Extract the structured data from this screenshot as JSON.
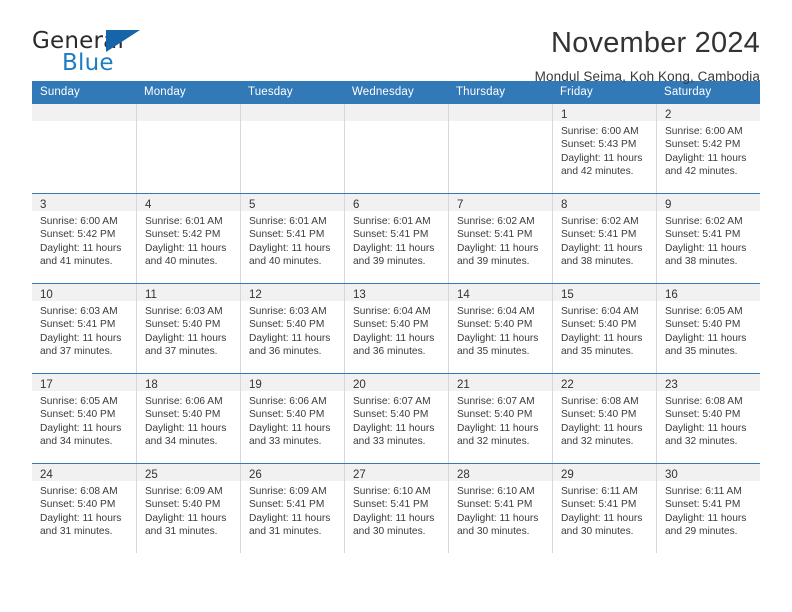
{
  "logo": {
    "word_one": "General",
    "word_two": "Blue",
    "triangle_icon": "blue-triangle-icon",
    "color_dark": "#2b2b2b",
    "color_blue": "#1b7dc4"
  },
  "header": {
    "title": "November 2024",
    "subtitle": "Mondul Seima, Koh Kong, Cambodia"
  },
  "theme": {
    "header_bg": "#3279b8",
    "day_band_bg": "#f1f1f1",
    "grid_line": "#d5d9dd",
    "row_line": "#3279b8"
  },
  "calendar": {
    "weekdays": [
      "Sunday",
      "Monday",
      "Tuesday",
      "Wednesday",
      "Thursday",
      "Friday",
      "Saturday"
    ],
    "weeks": [
      [
        {
          "day": "",
          "lines": []
        },
        {
          "day": "",
          "lines": []
        },
        {
          "day": "",
          "lines": []
        },
        {
          "day": "",
          "lines": []
        },
        {
          "day": "",
          "lines": []
        },
        {
          "day": "1",
          "lines": [
            "Sunrise: 6:00 AM",
            "Sunset: 5:43 PM",
            "Daylight: 11 hours",
            "and 42 minutes."
          ]
        },
        {
          "day": "2",
          "lines": [
            "Sunrise: 6:00 AM",
            "Sunset: 5:42 PM",
            "Daylight: 11 hours",
            "and 42 minutes."
          ]
        }
      ],
      [
        {
          "day": "3",
          "lines": [
            "Sunrise: 6:00 AM",
            "Sunset: 5:42 PM",
            "Daylight: 11 hours",
            "and 41 minutes."
          ]
        },
        {
          "day": "4",
          "lines": [
            "Sunrise: 6:01 AM",
            "Sunset: 5:42 PM",
            "Daylight: 11 hours",
            "and 40 minutes."
          ]
        },
        {
          "day": "5",
          "lines": [
            "Sunrise: 6:01 AM",
            "Sunset: 5:41 PM",
            "Daylight: 11 hours",
            "and 40 minutes."
          ]
        },
        {
          "day": "6",
          "lines": [
            "Sunrise: 6:01 AM",
            "Sunset: 5:41 PM",
            "Daylight: 11 hours",
            "and 39 minutes."
          ]
        },
        {
          "day": "7",
          "lines": [
            "Sunrise: 6:02 AM",
            "Sunset: 5:41 PM",
            "Daylight: 11 hours",
            "and 39 minutes."
          ]
        },
        {
          "day": "8",
          "lines": [
            "Sunrise: 6:02 AM",
            "Sunset: 5:41 PM",
            "Daylight: 11 hours",
            "and 38 minutes."
          ]
        },
        {
          "day": "9",
          "lines": [
            "Sunrise: 6:02 AM",
            "Sunset: 5:41 PM",
            "Daylight: 11 hours",
            "and 38 minutes."
          ]
        }
      ],
      [
        {
          "day": "10",
          "lines": [
            "Sunrise: 6:03 AM",
            "Sunset: 5:41 PM",
            "Daylight: 11 hours",
            "and 37 minutes."
          ]
        },
        {
          "day": "11",
          "lines": [
            "Sunrise: 6:03 AM",
            "Sunset: 5:40 PM",
            "Daylight: 11 hours",
            "and 37 minutes."
          ]
        },
        {
          "day": "12",
          "lines": [
            "Sunrise: 6:03 AM",
            "Sunset: 5:40 PM",
            "Daylight: 11 hours",
            "and 36 minutes."
          ]
        },
        {
          "day": "13",
          "lines": [
            "Sunrise: 6:04 AM",
            "Sunset: 5:40 PM",
            "Daylight: 11 hours",
            "and 36 minutes."
          ]
        },
        {
          "day": "14",
          "lines": [
            "Sunrise: 6:04 AM",
            "Sunset: 5:40 PM",
            "Daylight: 11 hours",
            "and 35 minutes."
          ]
        },
        {
          "day": "15",
          "lines": [
            "Sunrise: 6:04 AM",
            "Sunset: 5:40 PM",
            "Daylight: 11 hours",
            "and 35 minutes."
          ]
        },
        {
          "day": "16",
          "lines": [
            "Sunrise: 6:05 AM",
            "Sunset: 5:40 PM",
            "Daylight: 11 hours",
            "and 35 minutes."
          ]
        }
      ],
      [
        {
          "day": "17",
          "lines": [
            "Sunrise: 6:05 AM",
            "Sunset: 5:40 PM",
            "Daylight: 11 hours",
            "and 34 minutes."
          ]
        },
        {
          "day": "18",
          "lines": [
            "Sunrise: 6:06 AM",
            "Sunset: 5:40 PM",
            "Daylight: 11 hours",
            "and 34 minutes."
          ]
        },
        {
          "day": "19",
          "lines": [
            "Sunrise: 6:06 AM",
            "Sunset: 5:40 PM",
            "Daylight: 11 hours",
            "and 33 minutes."
          ]
        },
        {
          "day": "20",
          "lines": [
            "Sunrise: 6:07 AM",
            "Sunset: 5:40 PM",
            "Daylight: 11 hours",
            "and 33 minutes."
          ]
        },
        {
          "day": "21",
          "lines": [
            "Sunrise: 6:07 AM",
            "Sunset: 5:40 PM",
            "Daylight: 11 hours",
            "and 32 minutes."
          ]
        },
        {
          "day": "22",
          "lines": [
            "Sunrise: 6:08 AM",
            "Sunset: 5:40 PM",
            "Daylight: 11 hours",
            "and 32 minutes."
          ]
        },
        {
          "day": "23",
          "lines": [
            "Sunrise: 6:08 AM",
            "Sunset: 5:40 PM",
            "Daylight: 11 hours",
            "and 32 minutes."
          ]
        }
      ],
      [
        {
          "day": "24",
          "lines": [
            "Sunrise: 6:08 AM",
            "Sunset: 5:40 PM",
            "Daylight: 11 hours",
            "and 31 minutes."
          ]
        },
        {
          "day": "25",
          "lines": [
            "Sunrise: 6:09 AM",
            "Sunset: 5:40 PM",
            "Daylight: 11 hours",
            "and 31 minutes."
          ]
        },
        {
          "day": "26",
          "lines": [
            "Sunrise: 6:09 AM",
            "Sunset: 5:41 PM",
            "Daylight: 11 hours",
            "and 31 minutes."
          ]
        },
        {
          "day": "27",
          "lines": [
            "Sunrise: 6:10 AM",
            "Sunset: 5:41 PM",
            "Daylight: 11 hours",
            "and 30 minutes."
          ]
        },
        {
          "day": "28",
          "lines": [
            "Sunrise: 6:10 AM",
            "Sunset: 5:41 PM",
            "Daylight: 11 hours",
            "and 30 minutes."
          ]
        },
        {
          "day": "29",
          "lines": [
            "Sunrise: 6:11 AM",
            "Sunset: 5:41 PM",
            "Daylight: 11 hours",
            "and 30 minutes."
          ]
        },
        {
          "day": "30",
          "lines": [
            "Sunrise: 6:11 AM",
            "Sunset: 5:41 PM",
            "Daylight: 11 hours",
            "and 29 minutes."
          ]
        }
      ]
    ]
  }
}
